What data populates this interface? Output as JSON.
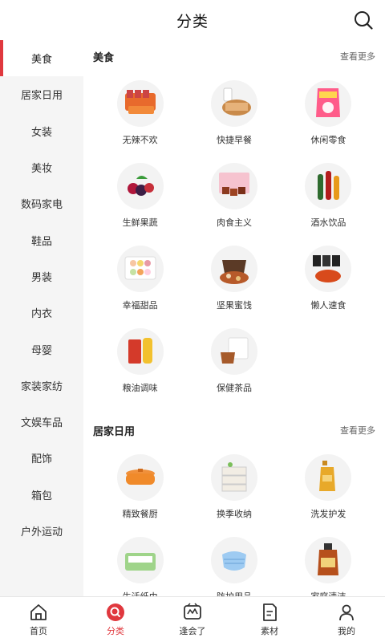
{
  "header": {
    "title": "分类"
  },
  "sidebar": {
    "items": [
      {
        "label": "美食"
      },
      {
        "label": "居家日用"
      },
      {
        "label": "女装"
      },
      {
        "label": "美妆"
      },
      {
        "label": "数码家电"
      },
      {
        "label": "鞋品"
      },
      {
        "label": "男装"
      },
      {
        "label": "内衣"
      },
      {
        "label": "母婴"
      },
      {
        "label": "家装家纺"
      },
      {
        "label": "文娱车品"
      },
      {
        "label": "配饰"
      },
      {
        "label": "箱包"
      },
      {
        "label": "户外运动"
      }
    ]
  },
  "sections": [
    {
      "title": "美食",
      "more": "查看更多",
      "items": [
        {
          "label": "无辣不欢"
        },
        {
          "label": "快捷早餐"
        },
        {
          "label": "休闲零食"
        },
        {
          "label": "生鲜果蔬"
        },
        {
          "label": "肉食主义"
        },
        {
          "label": "酒水饮品"
        },
        {
          "label": "幸福甜品"
        },
        {
          "label": "坚果蜜饯"
        },
        {
          "label": "懒人速食"
        },
        {
          "label": "粮油调味"
        },
        {
          "label": "保健茶品"
        }
      ]
    },
    {
      "title": "居家日用",
      "more": "查看更多",
      "items": [
        {
          "label": "精致餐厨"
        },
        {
          "label": "换季收纳"
        },
        {
          "label": "洗发护发"
        },
        {
          "label": "生活纸巾"
        },
        {
          "label": "防护用品"
        },
        {
          "label": "家庭清洁"
        }
      ]
    }
  ],
  "tabbar": {
    "items": [
      {
        "label": "首页"
      },
      {
        "label": "分类"
      },
      {
        "label": "逢会了"
      },
      {
        "label": "素材"
      },
      {
        "label": "我的"
      }
    ]
  }
}
